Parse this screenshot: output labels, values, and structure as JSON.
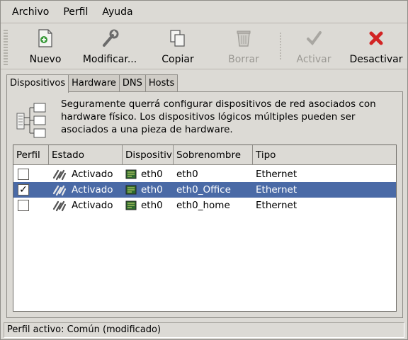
{
  "menu": {
    "archivo": "Archivo",
    "perfil": "Perfil",
    "ayuda": "Ayuda"
  },
  "toolbar": {
    "nuevo": "Nuevo",
    "modificar": "Modificar...",
    "copiar": "Copiar",
    "borrar": "Borrar",
    "activar": "Activar",
    "desactivar": "Desactivar"
  },
  "tabs": {
    "dispositivos": "Dispositivos",
    "hardware": "Hardware",
    "dns": "DNS",
    "hosts": "Hosts"
  },
  "info": {
    "text": "Seguramente querrá configurar dispositivos de red asociados con hardware físico. Los dispositivos lógicos múltiples pueden ser asociados a una pieza de hardware."
  },
  "table": {
    "headers": {
      "perfil": "Perfil",
      "estado": "Estado",
      "dispositivo": "Dispositiv",
      "sobrenombre": "Sobrenombre",
      "tipo": "Tipo"
    },
    "rows": [
      {
        "checked": "",
        "estado": "Activado",
        "dispositivo": "eth0",
        "sobrenombre": "eth0",
        "tipo": "Ethernet"
      },
      {
        "checked": "✓",
        "estado": "Activado",
        "dispositivo": "eth0",
        "sobrenombre": "eth0_Office",
        "tipo": "Ethernet"
      },
      {
        "checked": "",
        "estado": "Activado",
        "dispositivo": "eth0",
        "sobrenombre": "eth0_home",
        "tipo": "Ethernet"
      }
    ]
  },
  "status": {
    "text": "Perfil activo: Común (modificado)"
  },
  "colors": {
    "selection": "#4a6aa6",
    "window": "#dcdad5"
  }
}
